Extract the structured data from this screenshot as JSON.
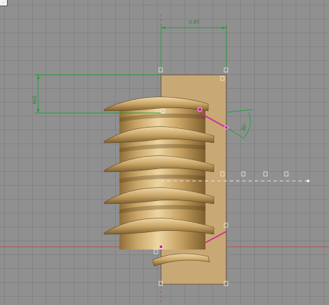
{
  "viewport": {
    "background_color": "#909090",
    "grid_color": "#7a7a7a",
    "corner_tab_label": "·"
  },
  "colors": {
    "thread_body": "#c9a567",
    "thread_highlight": "#e4c98f",
    "thread_shadow": "#8a6a35",
    "sketch_profile": "#c8a875",
    "dimension": "#1fa03a",
    "selection": "#d020a0",
    "axis_red": "#c43a3a"
  },
  "dimensions": {
    "width": "0.65",
    "pitch": "H/2",
    "angle": "30°"
  },
  "icons": [
    "point-marker-icon",
    "constraint-icon"
  ]
}
